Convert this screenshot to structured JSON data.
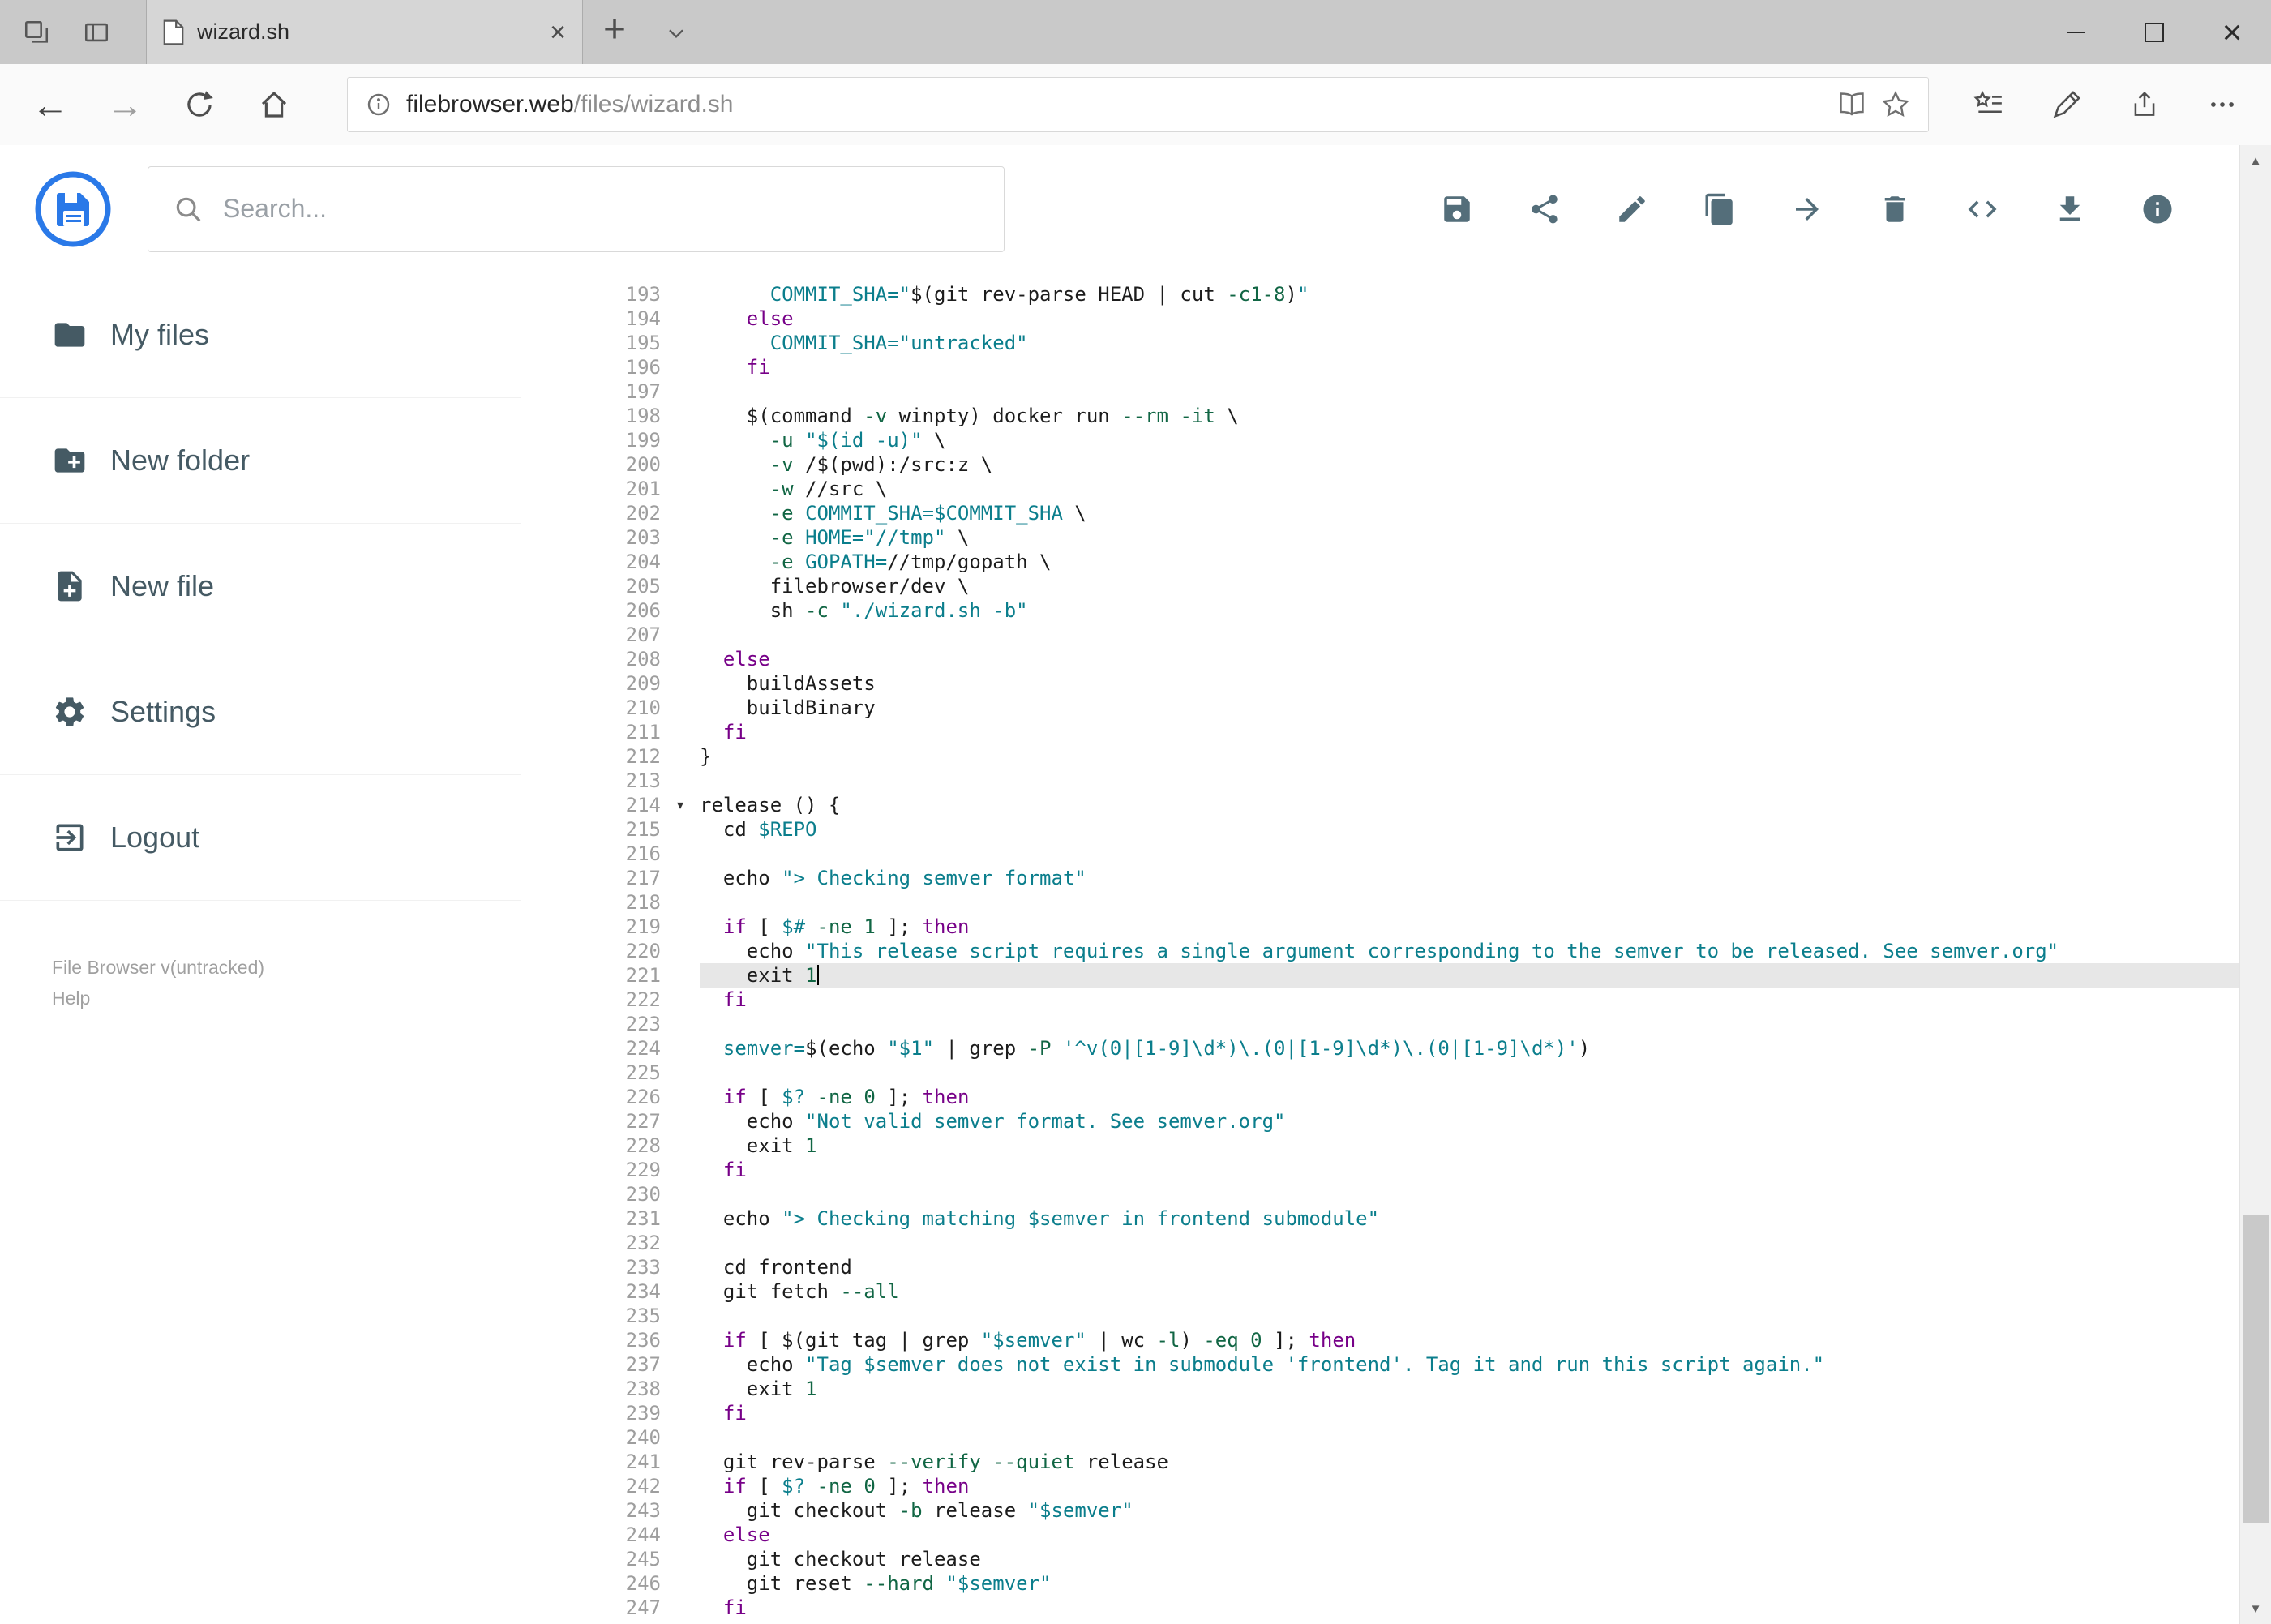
{
  "browser": {
    "tab_title": "wizard.sh",
    "url_host": "filebrowser.web",
    "url_path": "/files/wizard.sh"
  },
  "icons": {
    "close": "×",
    "new_tab": "+",
    "back": "←",
    "forward": "→",
    "scroll_up": "▲",
    "scroll_down": "▼",
    "fold": "▾"
  },
  "header": {
    "search_placeholder": "Search..."
  },
  "toolbar": {
    "buttons": [
      "save",
      "share",
      "edit",
      "copy",
      "move",
      "delete",
      "raw-code",
      "download",
      "info"
    ]
  },
  "sidebar": {
    "items": [
      {
        "label": "My files",
        "icon": "folder"
      },
      {
        "label": "New folder",
        "icon": "create-new-folder"
      },
      {
        "label": "New file",
        "icon": "note-add"
      },
      {
        "label": "Settings",
        "icon": "settings-gear"
      },
      {
        "label": "Logout",
        "icon": "logout"
      }
    ],
    "footer": {
      "version": "File Browser v(untracked)",
      "help": "Help"
    }
  },
  "colors": {
    "accent": "#2a79e8",
    "icon": "#546e7a",
    "sidebar_text": "#455a64",
    "kw": "#770088",
    "str": "#0b7e8c",
    "num": "#116644",
    "plain": "#1c1c1c",
    "lnum": "#9e9e9e",
    "activeline": "#e7e7e7"
  },
  "editor": {
    "active_line": 221,
    "fold_line": 214,
    "lines": [
      {
        "n": 193,
        "t": [
          [
            "p",
            "      "
          ],
          [
            "s",
            "COMMIT_SHA=\""
          ],
          [
            "p",
            "$(git rev-parse HEAD | cut "
          ],
          [
            "n",
            "-c1-8"
          ],
          [
            "p",
            ")"
          ],
          [
            "s",
            "\""
          ]
        ]
      },
      {
        "n": 194,
        "t": [
          [
            "p",
            "    "
          ],
          [
            "k",
            "else"
          ]
        ]
      },
      {
        "n": 195,
        "t": [
          [
            "p",
            "      "
          ],
          [
            "s",
            "COMMIT_SHA=\"untracked\""
          ]
        ]
      },
      {
        "n": 196,
        "t": [
          [
            "p",
            "    "
          ],
          [
            "k",
            "fi"
          ]
        ]
      },
      {
        "n": 197,
        "t": []
      },
      {
        "n": 198,
        "t": [
          [
            "p",
            "    $(command "
          ],
          [
            "n",
            "-v"
          ],
          [
            "p",
            " winpty) docker run "
          ],
          [
            "n",
            "--rm"
          ],
          [
            "p",
            " "
          ],
          [
            "n",
            "-it"
          ],
          [
            "p",
            " \\"
          ]
        ]
      },
      {
        "n": 199,
        "t": [
          [
            "p",
            "      "
          ],
          [
            "n",
            "-u"
          ],
          [
            "p",
            " "
          ],
          [
            "s",
            "\"$(id -u)\""
          ],
          [
            "p",
            " \\"
          ]
        ]
      },
      {
        "n": 200,
        "t": [
          [
            "p",
            "      "
          ],
          [
            "n",
            "-v"
          ],
          [
            "p",
            " /$(pwd):/src:z \\"
          ]
        ]
      },
      {
        "n": 201,
        "t": [
          [
            "p",
            "      "
          ],
          [
            "n",
            "-w"
          ],
          [
            "p",
            " //src \\"
          ]
        ]
      },
      {
        "n": 202,
        "t": [
          [
            "p",
            "      "
          ],
          [
            "n",
            "-e"
          ],
          [
            "p",
            " "
          ],
          [
            "s",
            "COMMIT_SHA=$COMMIT_SHA"
          ],
          [
            "p",
            " \\"
          ]
        ]
      },
      {
        "n": 203,
        "t": [
          [
            "p",
            "      "
          ],
          [
            "n",
            "-e"
          ],
          [
            "p",
            " "
          ],
          [
            "s",
            "HOME=\"//tmp\""
          ],
          [
            "p",
            " \\"
          ]
        ]
      },
      {
        "n": 204,
        "t": [
          [
            "p",
            "      "
          ],
          [
            "n",
            "-e"
          ],
          [
            "p",
            " "
          ],
          [
            "s",
            "GOPATH="
          ],
          [
            "p",
            "//tmp/gopath \\"
          ]
        ]
      },
      {
        "n": 205,
        "t": [
          [
            "p",
            "      filebrowser/dev \\"
          ]
        ]
      },
      {
        "n": 206,
        "t": [
          [
            "p",
            "      sh "
          ],
          [
            "n",
            "-c"
          ],
          [
            "p",
            " "
          ],
          [
            "s",
            "\"./wizard.sh -b\""
          ]
        ]
      },
      {
        "n": 207,
        "t": []
      },
      {
        "n": 208,
        "t": [
          [
            "p",
            "  "
          ],
          [
            "k",
            "else"
          ]
        ]
      },
      {
        "n": 209,
        "t": [
          [
            "p",
            "    buildAssets"
          ]
        ]
      },
      {
        "n": 210,
        "t": [
          [
            "p",
            "    buildBinary"
          ]
        ]
      },
      {
        "n": 211,
        "t": [
          [
            "p",
            "  "
          ],
          [
            "k",
            "fi"
          ]
        ]
      },
      {
        "n": 212,
        "t": [
          [
            "p",
            "}"
          ]
        ]
      },
      {
        "n": 213,
        "t": []
      },
      {
        "n": 214,
        "t": [
          [
            "p",
            "release () {"
          ]
        ]
      },
      {
        "n": 215,
        "t": [
          [
            "p",
            "  cd "
          ],
          [
            "s",
            "$REPO"
          ]
        ]
      },
      {
        "n": 216,
        "t": []
      },
      {
        "n": 217,
        "t": [
          [
            "p",
            "  echo "
          ],
          [
            "s",
            "\"> Checking semver format\""
          ]
        ]
      },
      {
        "n": 218,
        "t": []
      },
      {
        "n": 219,
        "t": [
          [
            "p",
            "  "
          ],
          [
            "k",
            "if"
          ],
          [
            "p",
            " [ "
          ],
          [
            "s",
            "$#"
          ],
          [
            "p",
            " "
          ],
          [
            "n",
            "-ne"
          ],
          [
            "p",
            " "
          ],
          [
            "n",
            "1"
          ],
          [
            "p",
            " ]; "
          ],
          [
            "k",
            "then"
          ]
        ]
      },
      {
        "n": 220,
        "t": [
          [
            "p",
            "    echo "
          ],
          [
            "s",
            "\"This release script requires a single argument corresponding to the semver to be released. See semver.org\""
          ]
        ]
      },
      {
        "n": 221,
        "t": [
          [
            "p",
            "    exit "
          ],
          [
            "n",
            "1"
          ]
        ]
      },
      {
        "n": 222,
        "t": [
          [
            "p",
            "  "
          ],
          [
            "k",
            "fi"
          ]
        ]
      },
      {
        "n": 223,
        "t": []
      },
      {
        "n": 224,
        "t": [
          [
            "p",
            "  "
          ],
          [
            "s",
            "semver="
          ],
          [
            "p",
            "$(echo "
          ],
          [
            "s",
            "\"$1\""
          ],
          [
            "p",
            " | grep "
          ],
          [
            "n",
            "-P"
          ],
          [
            "p",
            " "
          ],
          [
            "s",
            "'^v(0|[1-9]\\d*)\\.(0|[1-9]\\d*)\\.(0|[1-9]\\d*)'"
          ],
          [
            "p",
            ")"
          ]
        ]
      },
      {
        "n": 225,
        "t": []
      },
      {
        "n": 226,
        "t": [
          [
            "p",
            "  "
          ],
          [
            "k",
            "if"
          ],
          [
            "p",
            " [ "
          ],
          [
            "s",
            "$?"
          ],
          [
            "p",
            " "
          ],
          [
            "n",
            "-ne"
          ],
          [
            "p",
            " "
          ],
          [
            "n",
            "0"
          ],
          [
            "p",
            " ]; "
          ],
          [
            "k",
            "then"
          ]
        ]
      },
      {
        "n": 227,
        "t": [
          [
            "p",
            "    echo "
          ],
          [
            "s",
            "\"Not valid semver format. See semver.org\""
          ]
        ]
      },
      {
        "n": 228,
        "t": [
          [
            "p",
            "    exit "
          ],
          [
            "n",
            "1"
          ]
        ]
      },
      {
        "n": 229,
        "t": [
          [
            "p",
            "  "
          ],
          [
            "k",
            "fi"
          ]
        ]
      },
      {
        "n": 230,
        "t": []
      },
      {
        "n": 231,
        "t": [
          [
            "p",
            "  echo "
          ],
          [
            "s",
            "\"> Checking matching $semver in frontend submodule\""
          ]
        ]
      },
      {
        "n": 232,
        "t": []
      },
      {
        "n": 233,
        "t": [
          [
            "p",
            "  cd frontend"
          ]
        ]
      },
      {
        "n": 234,
        "t": [
          [
            "p",
            "  git fetch "
          ],
          [
            "n",
            "--all"
          ]
        ]
      },
      {
        "n": 235,
        "t": []
      },
      {
        "n": 236,
        "t": [
          [
            "p",
            "  "
          ],
          [
            "k",
            "if"
          ],
          [
            "p",
            " [ $(git tag | grep "
          ],
          [
            "s",
            "\"$semver\""
          ],
          [
            "p",
            " | wc "
          ],
          [
            "n",
            "-l"
          ],
          [
            "p",
            ") "
          ],
          [
            "n",
            "-eq"
          ],
          [
            "p",
            " "
          ],
          [
            "n",
            "0"
          ],
          [
            "p",
            " ]; "
          ],
          [
            "k",
            "then"
          ]
        ]
      },
      {
        "n": 237,
        "t": [
          [
            "p",
            "    echo "
          ],
          [
            "s",
            "\"Tag $semver does not exist in submodule 'frontend'. Tag it and run this script again.\""
          ]
        ]
      },
      {
        "n": 238,
        "t": [
          [
            "p",
            "    exit "
          ],
          [
            "n",
            "1"
          ]
        ]
      },
      {
        "n": 239,
        "t": [
          [
            "p",
            "  "
          ],
          [
            "k",
            "fi"
          ]
        ]
      },
      {
        "n": 240,
        "t": []
      },
      {
        "n": 241,
        "t": [
          [
            "p",
            "  git rev-parse "
          ],
          [
            "n",
            "--verify"
          ],
          [
            "p",
            " "
          ],
          [
            "n",
            "--quiet"
          ],
          [
            "p",
            " release"
          ]
        ]
      },
      {
        "n": 242,
        "t": [
          [
            "p",
            "  "
          ],
          [
            "k",
            "if"
          ],
          [
            "p",
            " [ "
          ],
          [
            "s",
            "$?"
          ],
          [
            "p",
            " "
          ],
          [
            "n",
            "-ne"
          ],
          [
            "p",
            " "
          ],
          [
            "n",
            "0"
          ],
          [
            "p",
            " ]; "
          ],
          [
            "k",
            "then"
          ]
        ]
      },
      {
        "n": 243,
        "t": [
          [
            "p",
            "    git checkout "
          ],
          [
            "n",
            "-b"
          ],
          [
            "p",
            " release "
          ],
          [
            "s",
            "\"$semver\""
          ]
        ]
      },
      {
        "n": 244,
        "t": [
          [
            "p",
            "  "
          ],
          [
            "k",
            "else"
          ]
        ]
      },
      {
        "n": 245,
        "t": [
          [
            "p",
            "    git checkout release"
          ]
        ]
      },
      {
        "n": 246,
        "t": [
          [
            "p",
            "    git reset "
          ],
          [
            "n",
            "--hard"
          ],
          [
            "p",
            " "
          ],
          [
            "s",
            "\"$semver\""
          ]
        ]
      },
      {
        "n": 247,
        "t": [
          [
            "p",
            "  "
          ],
          [
            "k",
            "fi"
          ]
        ]
      }
    ]
  }
}
